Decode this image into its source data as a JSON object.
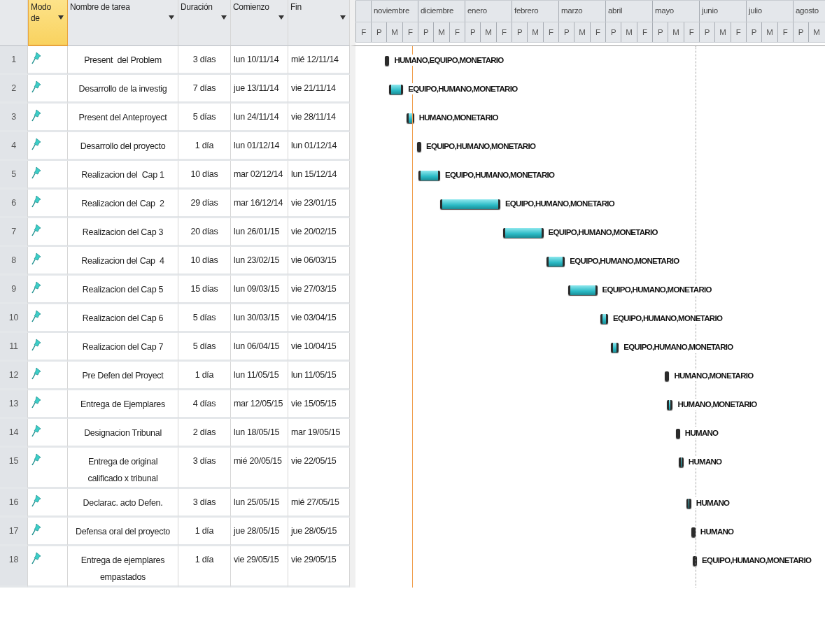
{
  "columns": [
    {
      "label": "Modo de",
      "selected": true
    },
    {
      "label": "Nombre de tarea",
      "selected": false
    },
    {
      "label": "Duración",
      "selected": false
    },
    {
      "label": "Comienzo",
      "selected": false
    },
    {
      "label": "Fin",
      "selected": false
    }
  ],
  "timeline": {
    "months": [
      "noviembre",
      "diciembre",
      "enero",
      "febrero",
      "marzo",
      "abril",
      "mayo",
      "junio",
      "julio",
      "agosto"
    ],
    "periods": [
      "F",
      "P",
      "M",
      "F",
      "P",
      "M",
      "F",
      "P",
      "M",
      "F",
      "P",
      "M",
      "F",
      "P",
      "M",
      "F",
      "P",
      "M",
      "F",
      "P",
      "M",
      "F",
      "P",
      "M",
      "F",
      "P",
      "M",
      "F",
      "P",
      "M"
    ]
  },
  "tasks": [
    {
      "id": "1",
      "name": "Present  del Problem",
      "duration": "3 días",
      "start": "lun 10/11/14",
      "finish": "mié 12/11/14",
      "resources": "HUMANO,EQUIPO,MONETARIO"
    },
    {
      "id": "2",
      "name": "Desarrollo de la investig",
      "duration": "7 días",
      "start": "jue 13/11/14",
      "finish": "vie 21/11/14",
      "resources": "EQUIPO,HUMANO,MONETARIO"
    },
    {
      "id": "3",
      "name": "Present del Anteproyect",
      "duration": "5 días",
      "start": "lun 24/11/14",
      "finish": "vie 28/11/14",
      "resources": "HUMANO,MONETARIO"
    },
    {
      "id": "4",
      "name": "Desarrollo del proyecto",
      "duration": "1 día",
      "start": "lun 01/12/14",
      "finish": "lun 01/12/14",
      "resources": "EQUIPO,HUMANO,MONETARIO"
    },
    {
      "id": "5",
      "name": "Realizacion del  Cap 1",
      "duration": "10 días",
      "start": "mar 02/12/14",
      "finish": "lun 15/12/14",
      "resources": "EQUIPO,HUMANO,MONETARIO"
    },
    {
      "id": "6",
      "name": "Realizacion del Cap  2",
      "duration": "29 días",
      "start": "mar 16/12/14",
      "finish": "vie 23/01/15",
      "resources": "EQUIPO,HUMANO,MONETARIO"
    },
    {
      "id": "7",
      "name": "Realizacion del Cap 3",
      "duration": "20 días",
      "start": "lun 26/01/15",
      "finish": "vie 20/02/15",
      "resources": "EQUIPO,HUMANO,MONETARIO"
    },
    {
      "id": "8",
      "name": "Realizacion del Cap  4",
      "duration": "10 días",
      "start": "lun 23/02/15",
      "finish": "vie 06/03/15",
      "resources": "EQUIPO,HUMANO,MONETARIO"
    },
    {
      "id": "9",
      "name": "Realizacion del Cap 5",
      "duration": "15 días",
      "start": "lun 09/03/15",
      "finish": "vie 27/03/15",
      "resources": "EQUIPO,HUMANO,MONETARIO"
    },
    {
      "id": "10",
      "name": "Realizacion del Cap 6",
      "duration": "5 días",
      "start": "lun 30/03/15",
      "finish": "vie 03/04/15",
      "resources": "EQUIPO,HUMANO,MONETARIO"
    },
    {
      "id": "11",
      "name": "Realizacion del Cap 7",
      "duration": "5 días",
      "start": "lun 06/04/15",
      "finish": "vie 10/04/15",
      "resources": "EQUIPO,HUMANO,MONETARIO"
    },
    {
      "id": "12",
      "name": "Pre Defen del Proyect",
      "duration": "1 día",
      "start": "lun 11/05/15",
      "finish": "lun 11/05/15",
      "resources": "HUMANO,MONETARIO"
    },
    {
      "id": "13",
      "name": "Entrega de Ejemplares",
      "duration": "4 días",
      "start": "mar 12/05/15",
      "finish": "vie 15/05/15",
      "resources": "HUMANO,MONETARIO"
    },
    {
      "id": "14",
      "name": "Designacion Tribunal",
      "duration": "2 días",
      "start": "lun 18/05/15",
      "finish": "mar 19/05/15",
      "resources": "HUMANO"
    },
    {
      "id": "15",
      "name": "Entrega de original calificado x tribunal",
      "duration": "3 días",
      "start": "mié 20/05/15",
      "finish": "vie 22/05/15",
      "resources": "HUMANO"
    },
    {
      "id": "16",
      "name": "Declarac. acto Defen.",
      "duration": "3 días",
      "start": "lun 25/05/15",
      "finish": "mié 27/05/15",
      "resources": "HUMANO"
    },
    {
      "id": "17",
      "name": "Defensa oral del proyecto",
      "duration": "1 día",
      "start": "jue 28/05/15",
      "finish": "jue 28/05/15",
      "resources": "HUMANO"
    },
    {
      "id": "18",
      "name": "Entrega de ejemplares empastados",
      "duration": "1 día",
      "start": "vie 29/05/15",
      "finish": "vie 29/05/15",
      "resources": "EQUIPO,HUMANO,MONETARIO"
    }
  ]
}
